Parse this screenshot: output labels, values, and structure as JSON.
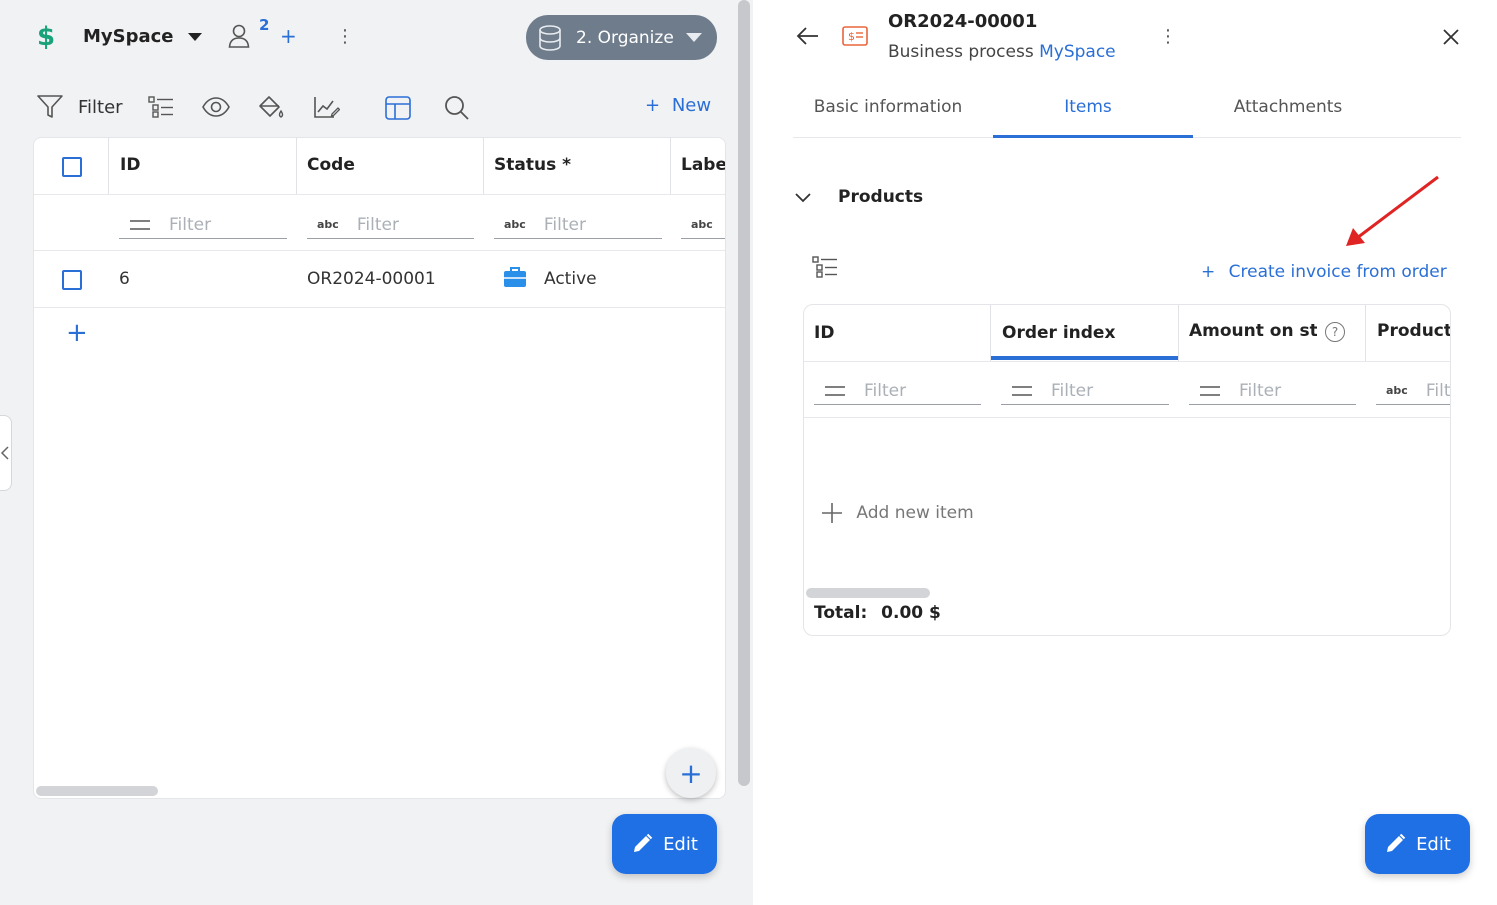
{
  "workspace": {
    "name": "MySpace",
    "members_count": "2",
    "stage_label": "2. Organize"
  },
  "toolbar": {
    "filter_label": "Filter",
    "new_label": "New"
  },
  "grid": {
    "columns": [
      "ID",
      "Code",
      "Status *",
      "Label"
    ],
    "filter_placeholder": "Filter",
    "abc_label": "abc",
    "rows": [
      {
        "id": "6",
        "code": "OR2024-00001",
        "status": "Active"
      }
    ]
  },
  "edit_label": "Edit",
  "record": {
    "title": "OR2024-00001",
    "subtitle_prefix": "Business process",
    "subtitle_link": "MySpace"
  },
  "tabs": [
    "Basic information",
    "Items",
    "Attachments"
  ],
  "products": {
    "section_title": "Products",
    "create_invoice_label": "Create invoice from order",
    "columns": [
      "ID",
      "Order index",
      "Amount on stoc",
      "Products"
    ],
    "filter_placeholder": "Filter",
    "abc_label": "abc",
    "filter_cut": "Filt",
    "help_glyph": "?",
    "add_item_label": "Add new item",
    "total_label": "Total:",
    "total_value": "0.00 $"
  },
  "colors": {
    "accent": "#2a6fd6",
    "edit_button": "#1f6fe5",
    "organize_pill": "#6f7c8c",
    "status_icon": "#2a8fe8",
    "record_icon": "#e8663d",
    "arrow": "#e02424"
  }
}
